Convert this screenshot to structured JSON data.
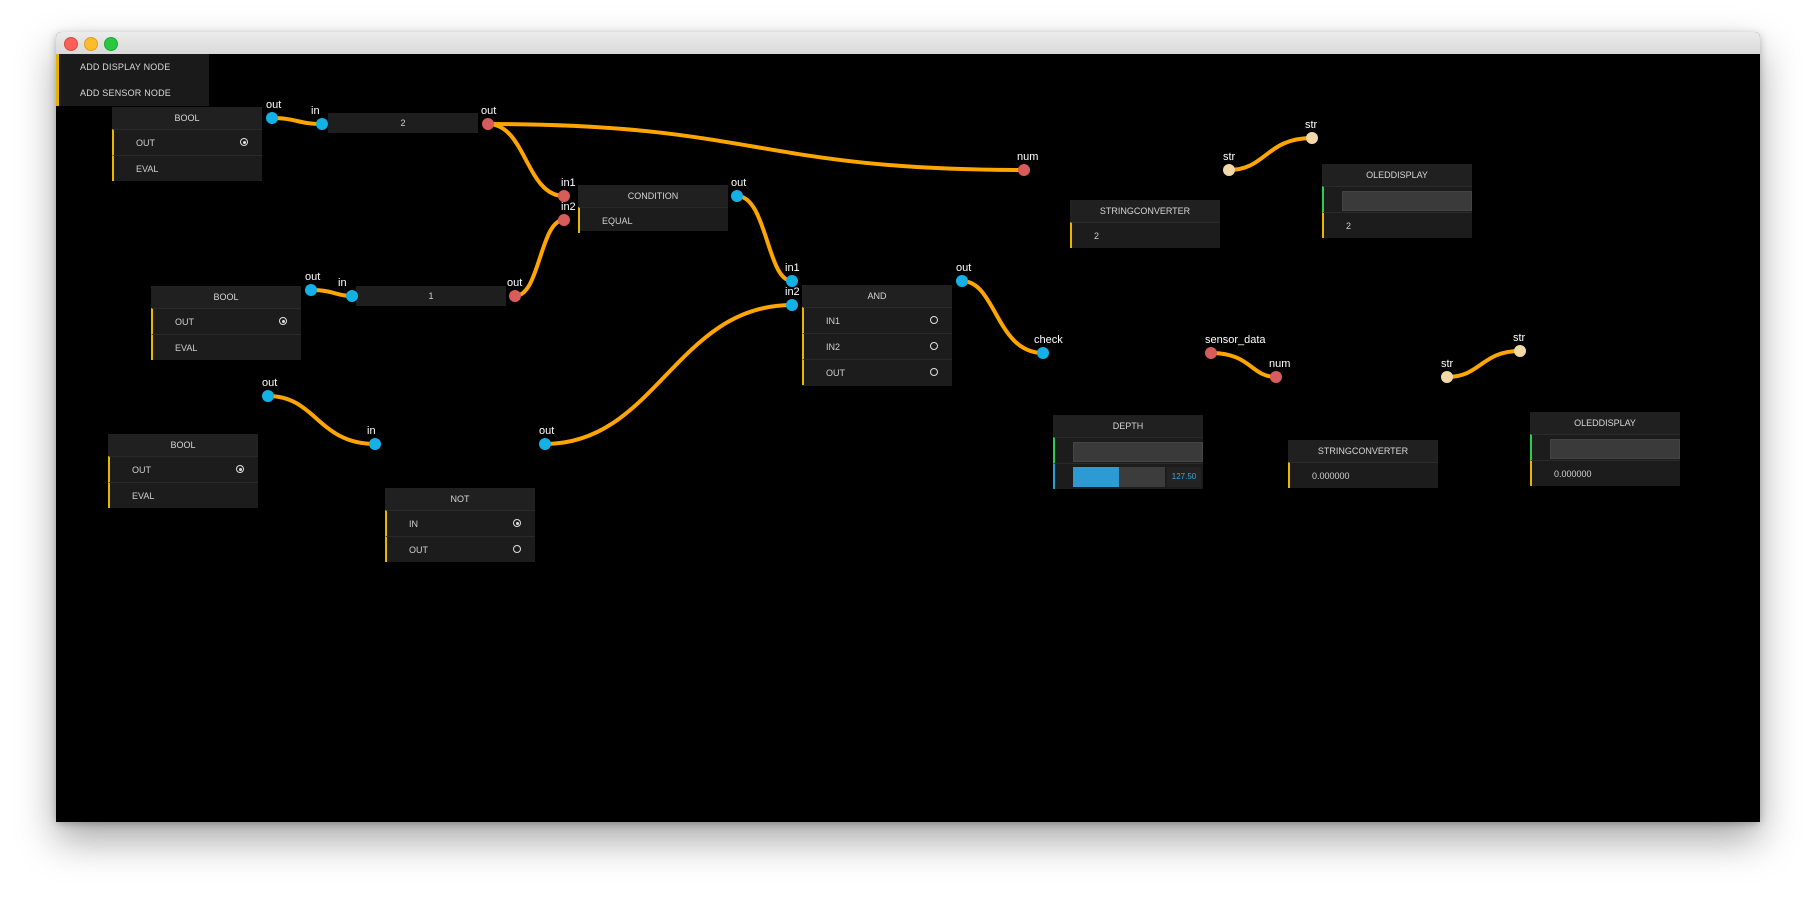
{
  "menu": {
    "add_display": "ADD DISPLAY NODE",
    "add_sensor": "ADD SENSOR NODE"
  },
  "port_labels": {
    "out": "out",
    "in": "in",
    "in1": "in1",
    "in2": "in2",
    "num": "num",
    "str": "str",
    "check": "check",
    "sensor_data": "sensor_data"
  },
  "nodes": {
    "bool1": {
      "title": "BOOL",
      "rows": [
        "OUT",
        "EVAL"
      ]
    },
    "bool2": {
      "title": "BOOL",
      "rows": [
        "OUT",
        "EVAL"
      ]
    },
    "bool3": {
      "title": "BOOL",
      "rows": [
        "OUT",
        "EVAL"
      ]
    },
    "value1": {
      "value": "2"
    },
    "value2": {
      "value": "1"
    },
    "condition": {
      "title": "CONDITION",
      "rows": [
        "EQUAL"
      ]
    },
    "and": {
      "title": "AND",
      "rows": [
        "IN1",
        "IN2",
        "OUT"
      ]
    },
    "not": {
      "title": "NOT",
      "rows": [
        "IN",
        "OUT"
      ]
    },
    "strconv1": {
      "title": "STRINGCONVERTER",
      "value": "2"
    },
    "oled1": {
      "title": "OLEDDISPLAY",
      "value": "2"
    },
    "depth": {
      "title": "DEPTH",
      "slider_value": "127.50",
      "slider_fraction": 0.5
    },
    "strconv2": {
      "title": "STRINGCONVERTER",
      "value": "0.000000"
    },
    "oled2": {
      "title": "OLEDDISPLAY",
      "value": "0.000000"
    }
  },
  "colors": {
    "wire": "#ffa500",
    "port_bool": "#14b1e7",
    "port_number": "#d95c5c",
    "port_string": "#f3d9a8",
    "row_accent": "#e6b800",
    "display_accent": "#2ecc52",
    "slider": "#2d9ad3"
  }
}
